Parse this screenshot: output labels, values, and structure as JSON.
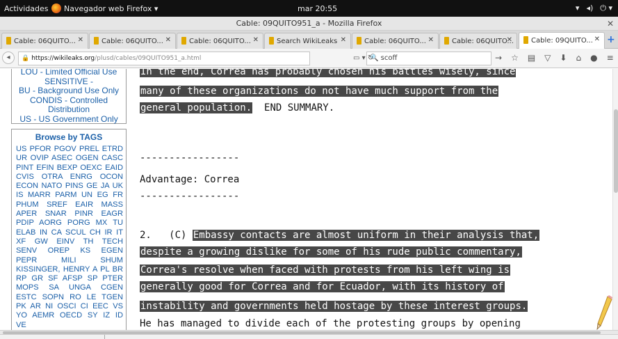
{
  "topbar": {
    "activities": "Actividades",
    "app_menu": "Navegador web Firefox ▾",
    "clock": "mar 20:55",
    "sys_icons": [
      "wifi-icon",
      "volume-icon",
      "power-icon"
    ]
  },
  "window": {
    "title": "Cable: 09QUITO951_a - Mozilla Firefox"
  },
  "tabs": [
    {
      "label": "Cable: 06QUITO...",
      "active": false
    },
    {
      "label": "Cable: 06QUITO...",
      "active": false
    },
    {
      "label": "Cable: 06QUITO...",
      "active": false
    },
    {
      "label": "Search WikiLeaks",
      "active": false
    },
    {
      "label": "Cable: 06QUITO...",
      "active": false
    },
    {
      "label": "Cable: 06QUITO...",
      "active": false
    },
    {
      "label": "Cable: 09QUITO...",
      "active": true
    }
  ],
  "navbar": {
    "url_host": "https://wikileaks.org",
    "url_path": "/plusd/cables/09QUITO951_a.html",
    "search_value": "scoff"
  },
  "sidebar": {
    "classification_lines": [
      "LOU - Limited Official Use",
      "SENSITIVE -",
      "BU - Background Use Only",
      "CONDIS - Controlled",
      "Distribution",
      "US - US Government Only"
    ],
    "tags_header": "Browse by TAGS",
    "tags_text": "US PFOR PGOV PREL ETRD UR OVIP ASEC OGEN CASC PINT EFIN BEXP OEXC EAID CVIS OTRA ENRG OCON ECON NATO PINS GE JA UK IS MARR PARM UN EG FR PHUM SREF EAIR MASS APER SNAR PINR EAGR PDIP AORG PORG MX TU ELAB IN CA SCUL CH IR IT XF GW EINV TH TECH SENV OREP KS EGEN PEPR MILI SHUM KISSINGER, HENRY A PL BR RP GR SF AFSP SP PTER MOPS SA UNGA CGEN ESTC SOPN RO LE TGEN PK AR NI OSCI CI EEC VS YO AEMR OECD SY IZ ID VE"
  },
  "cable": {
    "lines": [
      {
        "hl": "In the end, Correa has probably chosen his battles wisely, since",
        "plain": ""
      },
      {
        "hl": "many of these organizations do not have much support from the",
        "plain": ""
      },
      {
        "hl": "general population.",
        "plain": "  END SUMMARY."
      },
      {
        "hl": "",
        "plain": ""
      },
      {
        "hl": "",
        "plain": ""
      },
      {
        "hl": "",
        "plain": "-----------------"
      },
      {
        "hl": "",
        "plain": "Advantage: Correa"
      },
      {
        "hl": "",
        "plain": "-----------------"
      },
      {
        "hl": "",
        "plain": ""
      },
      {
        "prefix": "2.   (C) ",
        "hl": "Embassy contacts are almost uniform in their analysis that,",
        "plain": ""
      },
      {
        "hl": "despite a growing dislike for some of his rude public commentary,",
        "plain": ""
      },
      {
        "hl": "Correa's resolve when faced with protests from his left wing is",
        "plain": ""
      },
      {
        "hl": "generally good for Correa and for Ecuador, with its history of",
        "plain": ""
      },
      {
        "hl": "instability and governments held hostage by these interest groups.",
        "plain": ""
      },
      {
        "hl": "",
        "plain": "He has managed to divide each of the protesting groups by opening"
      }
    ]
  },
  "colors": {
    "highlight_bg": "#474747",
    "sidebar_link": "#1a5fa8"
  }
}
